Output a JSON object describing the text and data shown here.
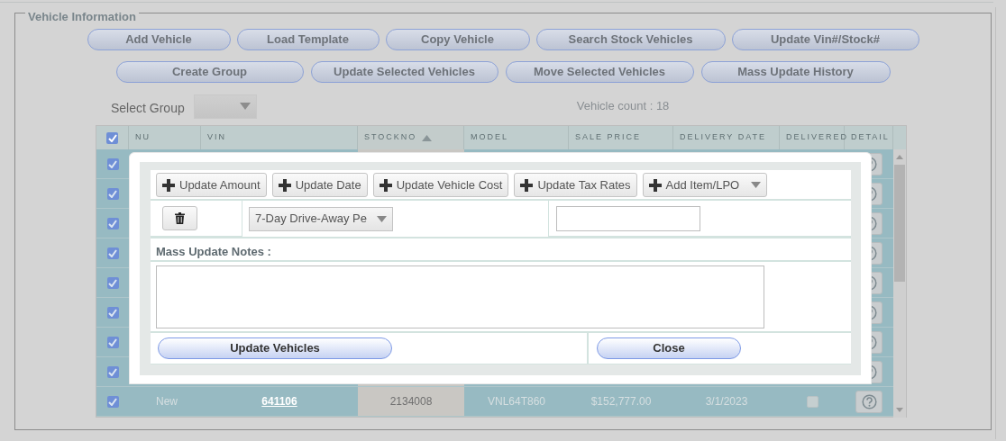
{
  "section": {
    "title": "Vehicle Information"
  },
  "toolbar_rows": [
    [
      "Add Vehicle",
      "Load Template",
      "Copy Vehicle",
      "Search Stock Vehicles",
      "Update Vin#/Stock#"
    ],
    [
      "Create Group",
      "Update Selected Vehicles",
      "Move Selected Vehicles",
      "Mass Update History"
    ]
  ],
  "select_group": {
    "label": "Select Group"
  },
  "vehicle_count": "Vehicle count : 18",
  "table": {
    "select_all": true,
    "columns": [
      {
        "label": "NU",
        "sorted": false
      },
      {
        "label": "VIN",
        "sorted": false
      },
      {
        "label": "STOCKNO",
        "sorted": true
      },
      {
        "label": "MODEL",
        "sorted": false
      },
      {
        "label": "SALE PRICE",
        "sorted": false
      },
      {
        "label": "DELIVERY DATE",
        "sorted": false
      },
      {
        "label": "DELIVERED",
        "sorted": false
      },
      {
        "label": "DETAIL",
        "sorted": false
      }
    ],
    "rows": [
      {
        "selected": true
      },
      {
        "selected": true
      },
      {
        "selected": true
      },
      {
        "selected": true
      },
      {
        "selected": true
      },
      {
        "selected": true
      },
      {
        "selected": true
      },
      {
        "selected": true
      },
      {
        "selected": true,
        "nu": "New",
        "vin": "641106",
        "stockno": "2134008",
        "model": "VNL64T860",
        "sale_price": "$152,777.00",
        "delivery_date": "3/1/2023",
        "delivered": false
      }
    ]
  },
  "dialog": {
    "actions": [
      {
        "label": "Update Amount",
        "kind": "button"
      },
      {
        "label": "Update Date",
        "kind": "button"
      },
      {
        "label": "Update Vehicle Cost",
        "kind": "button"
      },
      {
        "label": "Update Tax Rates",
        "kind": "button"
      },
      {
        "label": "Add Item/LPO",
        "kind": "dropdown"
      }
    ],
    "line_item": {
      "type": "7-Day Drive-Away Pe"
    },
    "notes_label": "Mass Update Notes :",
    "buttons": [
      "Update Vehicles",
      "Close"
    ]
  }
}
